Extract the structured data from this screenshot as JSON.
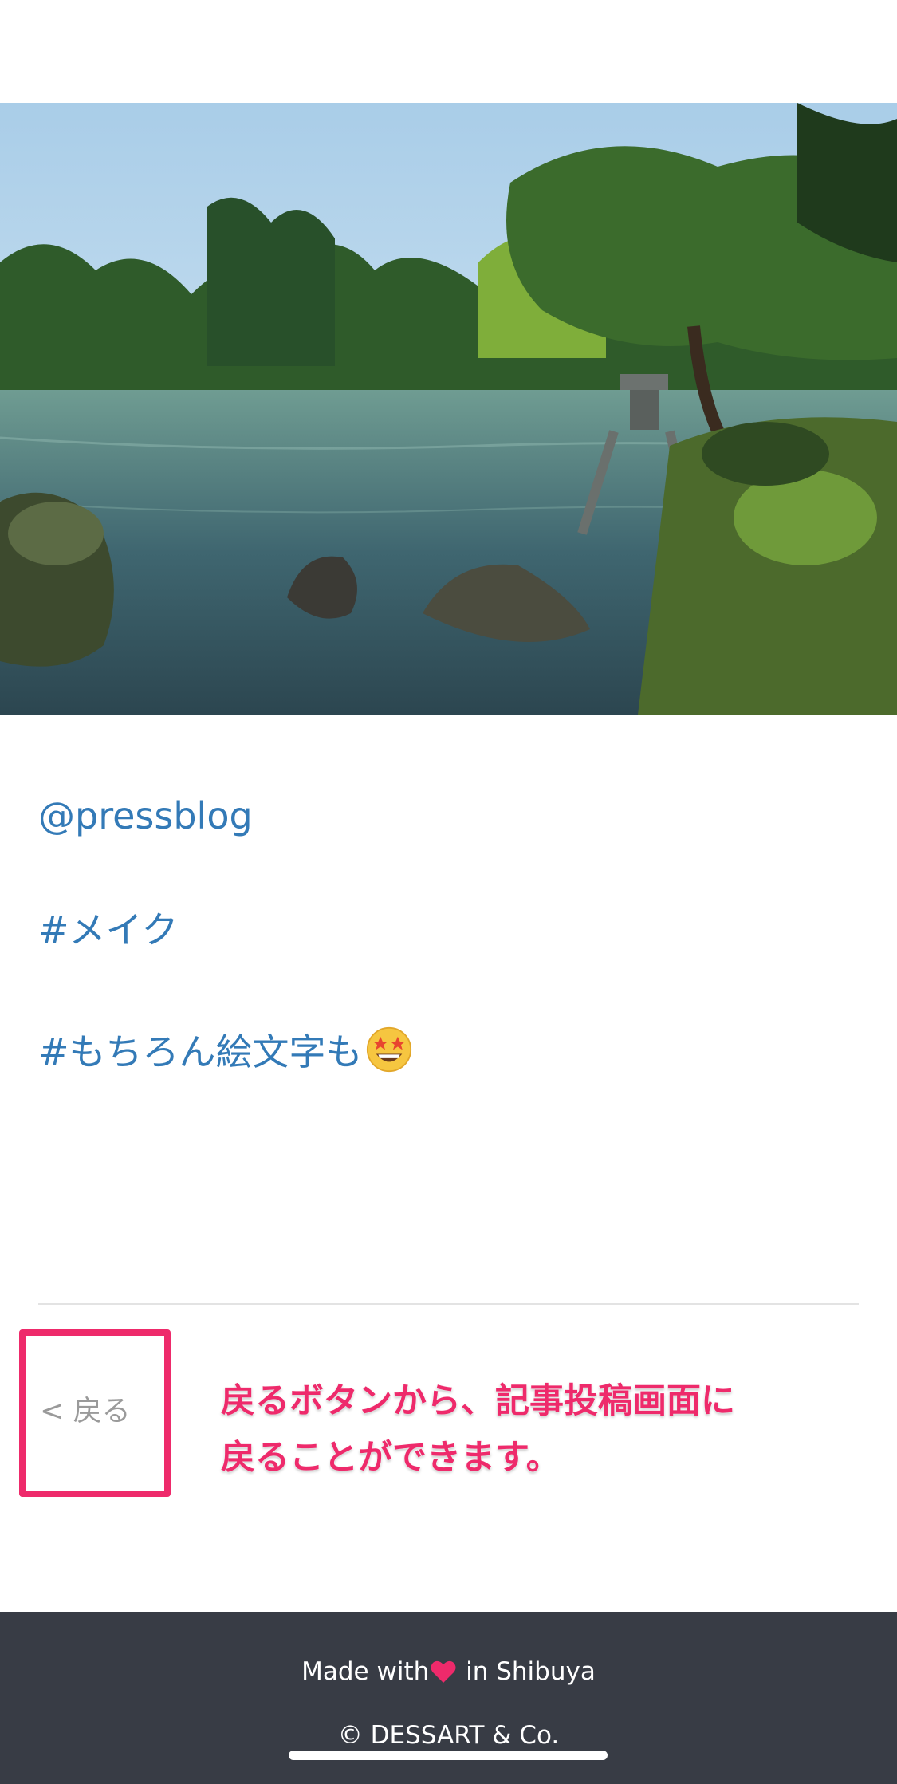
{
  "hero": {
    "image_icon": "garden-pond-photo"
  },
  "links": {
    "mention": "@pressblog",
    "hashtag1": "#メイク",
    "hashtag2": "#もちろん絵文字も",
    "emoji_icon": "star-struck-emoji"
  },
  "back": {
    "label": "< 戻る"
  },
  "annotation": {
    "line1": "戻るボタンから、記事投稿画面に",
    "line2": "戻ることができます。",
    "color": "#ee2a6b"
  },
  "footer": {
    "made_with": "Made with",
    "in_shibuya": "in Shibuya",
    "heart_icon": "heart-icon",
    "copyright": "© DESSART & Co.",
    "background": "#383c45"
  },
  "colors": {
    "link": "#337ab7",
    "highlight": "#ee2a6b"
  }
}
